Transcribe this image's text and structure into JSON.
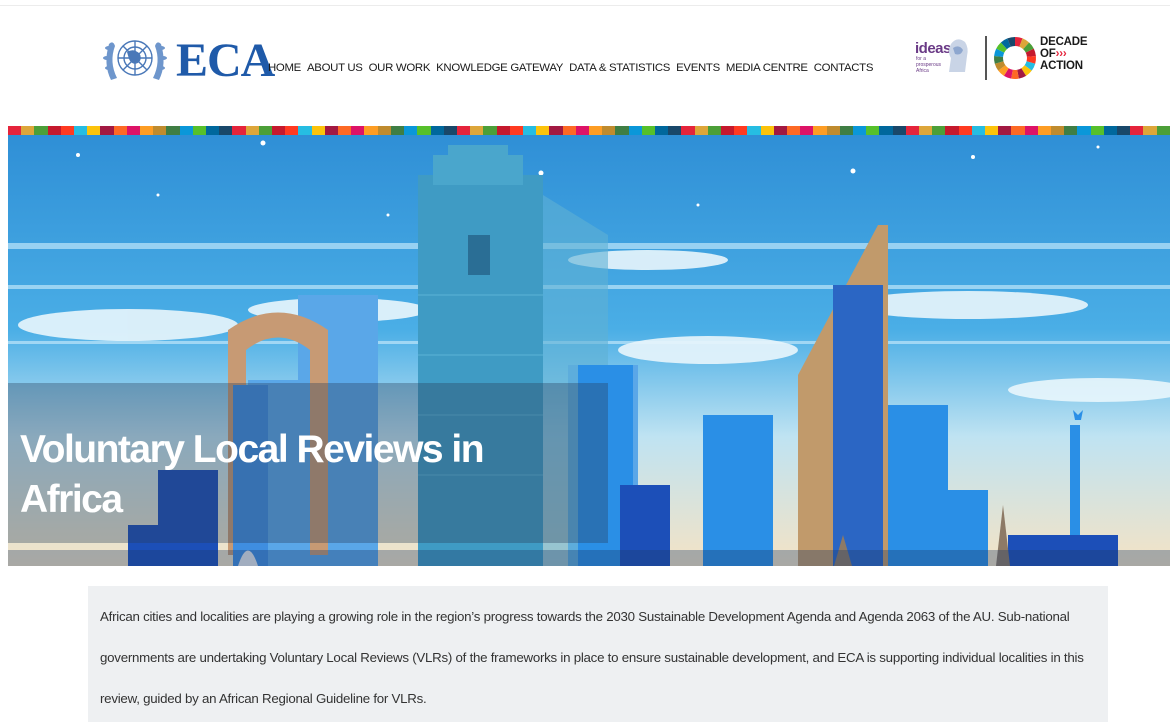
{
  "brand": {
    "name": "ECA"
  },
  "nav": {
    "items": [
      "HOME",
      "ABOUT US",
      "OUR WORK",
      "KNOWLEDGE GATEWAY",
      "DATA & STATISTICS",
      "EVENTS",
      "MEDIA CENTRE",
      "CONTACTS"
    ]
  },
  "partners": {
    "ideas": "ideas",
    "ideas_sub": "for a prosperous Africa",
    "decade_line1": "DECADE",
    "decade_line2": "OF",
    "decade_arrows": "›››",
    "decade_line3": "ACTION"
  },
  "colors": {
    "brand_blue": "#1f5aa9",
    "sdg": [
      "#e5243b",
      "#dda63a",
      "#4c9f38",
      "#c5192d",
      "#ff3a21",
      "#26bde2",
      "#fcc30b",
      "#a21942",
      "#fd6925",
      "#dd1367",
      "#fd9d24",
      "#bf8b2e",
      "#3f7e44",
      "#0a97d9",
      "#56c02b",
      "#00689d",
      "#19486a"
    ]
  },
  "hero": {
    "title": "Voluntary Local Reviews in Africa"
  },
  "intro": {
    "text": "African cities and localities are playing a growing role in the region’s progress towards the 2030 Sustainable Development Agenda and Agenda 2063 of the AU. Sub-national governments are undertaking Voluntary Local Reviews (VLRs) of the frameworks in place to ensure sustainable development, and ECA is supporting individual localities in this review, guided by an African Regional Guideline for VLRs."
  }
}
